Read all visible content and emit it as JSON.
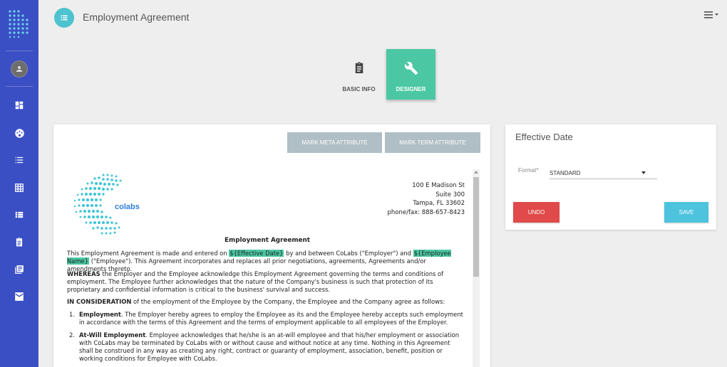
{
  "header": {
    "title": "Employment Agreement"
  },
  "sidebar": {
    "items": [
      {
        "icon": "dashboard-icon"
      },
      {
        "icon": "palette-icon"
      },
      {
        "icon": "list-icon"
      },
      {
        "icon": "grid-icon"
      },
      {
        "icon": "view-list-icon"
      },
      {
        "icon": "clipboard-icon"
      },
      {
        "icon": "library-icon"
      },
      {
        "icon": "mail-icon"
      }
    ]
  },
  "steps": {
    "basic_info": "BASIC INFO",
    "designer": "DESIGNER"
  },
  "editor": {
    "mark_meta": "MARK META ATTRIBUTE",
    "mark_term": "MARK TERM ATTRIBUTE"
  },
  "document": {
    "company_logo_text": "colabs",
    "address": {
      "line1": "100 E Madison St",
      "line2": "Suite 300",
      "line3": "Tampa, FL 33602",
      "line4": "phone/fax:  888-657-8423"
    },
    "title": "Employment Agreement",
    "p1_a": "This Employment Agreement is made and entered on ",
    "p1_tag1": "${Effective Date}",
    "p1_b": " by and between CoLabs (\"Employer\") and ",
    "p1_tag2": "${Employee Name}",
    "p1_c": " (\"Employee\"). This Agreement incorporates and replaces all prior negotiations, agreements, Agreements and/or amendments thereto.",
    "p2_bold": "WHEREAS",
    "p2_text": " the Employer and the Employee acknowledge this Employment Agreement governing the terms and conditions of employment. The Employee further acknowledges that the nature of the Company's business is such that protection of its proprietary and confidential information is critical to the business' survival and success.",
    "p3_bold": "IN CONSIDERATION",
    "p3_text": " of the employment of the Employee by the Company, the Employee and the Company agree as follows:",
    "items": [
      {
        "num": "1.",
        "heading": "Employment",
        "text": ". The Employer hereby agrees to employ the Employee as its and the Employee hereby accepts such employment in accordance with the terms of this Agreement and the terms of employment applicable to all employees of the Employer."
      },
      {
        "num": "2.",
        "heading": "At-Will Employment",
        "text": ". Employee acknowledges that he/she is an at-will employee and that his/her employment or association with CoLabs may be terminated by CoLabs with or without cause and without notice at any time. Nothing in this Agreement shall be construed in any way as creating any right, contract or guaranty of employment, association, benefit, position or working conditions for Employee with CoLabs."
      }
    ]
  },
  "side_panel": {
    "title": "Effective Date",
    "format_label": "Format*",
    "format_value": "STANDARD",
    "undo": "UNDO",
    "save": "SAVE"
  },
  "colors": {
    "sidebar": "#3b4fc4",
    "accent_teal": "#4bc8a3",
    "undo_red": "#e04a4a",
    "save_blue": "#4dc3de"
  }
}
